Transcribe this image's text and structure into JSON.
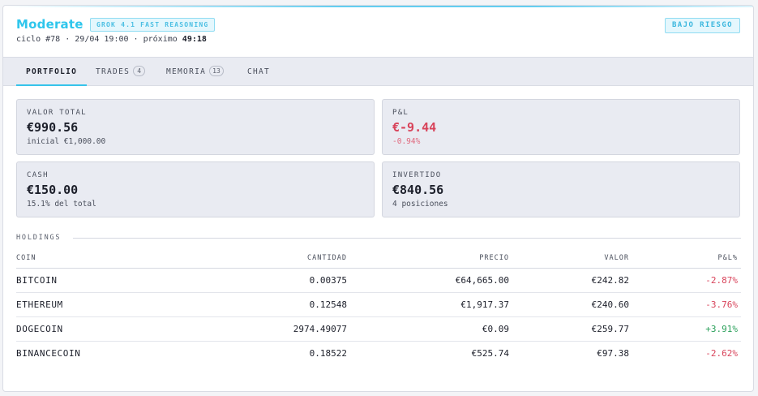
{
  "header": {
    "title": "Moderate",
    "model_badge": "GROK 4.1 FAST REASONING",
    "cycle": "ciclo #78",
    "datetime": "29/04 19:00",
    "next_label": "próximo",
    "next_value": "49:18",
    "separator": "·",
    "risk_badge": "BAJO RIESGO",
    "colors": {
      "accent": "#2fc6ec",
      "negative": "#d8435a",
      "positive": "#2aa05a"
    }
  },
  "tabs": [
    {
      "label": "PORTFOLIO",
      "count": ""
    },
    {
      "label": "TRADES",
      "count": "4"
    },
    {
      "label": "MEMORIA",
      "count": "13"
    },
    {
      "label": "CHAT",
      "count": ""
    }
  ],
  "cards": {
    "total": {
      "label": "VALOR TOTAL",
      "value": "€990.56",
      "sub": "inicial €1,000.00"
    },
    "pnl": {
      "label": "P&L",
      "value": "€-9.44",
      "sub": "-0.94%"
    },
    "cash": {
      "label": "CASH",
      "value": "€150.00",
      "sub": "15.1% del total"
    },
    "invested": {
      "label": "INVERTIDO",
      "value": "€840.56",
      "sub": "4 posiciones"
    }
  },
  "holdings": {
    "title": "HOLDINGS",
    "columns": [
      "COIN",
      "CANTIDAD",
      "PRECIO",
      "VALOR",
      "P&L%"
    ],
    "rows": [
      {
        "coin": "BITCOIN",
        "cantidad": "0.00375",
        "precio": "€64,665.00",
        "valor": "€242.82",
        "pnl": "-2.87%"
      },
      {
        "coin": "ETHEREUM",
        "cantidad": "0.12548",
        "precio": "€1,917.37",
        "valor": "€240.60",
        "pnl": "-3.76%"
      },
      {
        "coin": "DOGECOIN",
        "cantidad": "2974.49077",
        "precio": "€0.09",
        "valor": "€259.77",
        "pnl": "+3.91%"
      },
      {
        "coin": "BINANCECOIN",
        "cantidad": "0.18522",
        "precio": "€525.74",
        "valor": "€97.38",
        "pnl": "-2.62%"
      }
    ]
  }
}
